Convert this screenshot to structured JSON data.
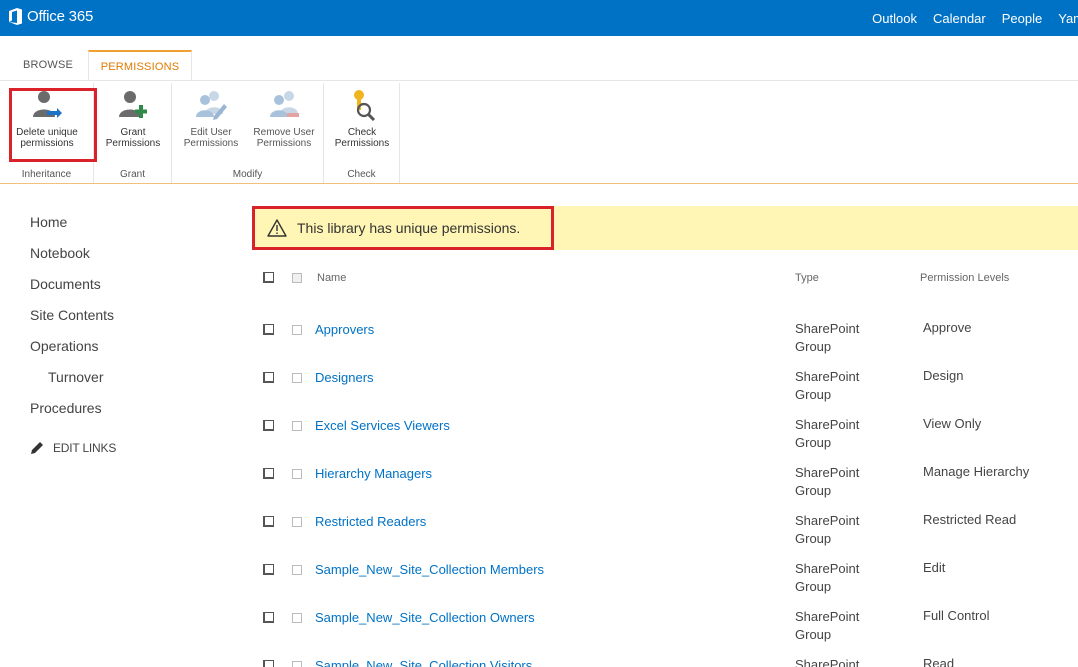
{
  "suite_bar": {
    "brand": "Office 365",
    "links": [
      "Outlook",
      "Calendar",
      "People",
      "Yam"
    ],
    "color": "#0072c6"
  },
  "ribbon": {
    "tabs": [
      "BROWSE",
      "PERMISSIONS"
    ],
    "active_tab": "PERMISSIONS",
    "groups": [
      {
        "label": "Inheritance",
        "buttons": [
          {
            "label": "Delete unique\npermissions",
            "icon": "delete-inheritance-icon"
          }
        ]
      },
      {
        "label": "Grant",
        "buttons": [
          {
            "label": "Grant\nPermissions",
            "icon": "grant-permissions-icon"
          }
        ]
      },
      {
        "label": "Modify",
        "buttons": [
          {
            "label": "Edit User\nPermissions",
            "icon": "edit-user-permissions-icon"
          },
          {
            "label": "Remove User\nPermissions",
            "icon": "remove-user-permissions-icon"
          }
        ]
      },
      {
        "label": "Check",
        "buttons": [
          {
            "label": "Check\nPermissions",
            "icon": "check-permissions-icon"
          }
        ]
      }
    ]
  },
  "left_nav": {
    "items": [
      "Home",
      "Notebook",
      "Documents",
      "Site Contents",
      "Operations",
      "Turnover",
      "Procedures"
    ],
    "edit_links": "EDIT LINKS"
  },
  "notice": {
    "text": "This library has unique permissions.",
    "icon": "warning-icon"
  },
  "table": {
    "columns": [
      "Name",
      "Type",
      "Permission Levels"
    ],
    "rows": [
      {
        "name": "Approvers",
        "type": "SharePoint Group",
        "level": "Approve"
      },
      {
        "name": "Designers",
        "type": "SharePoint Group",
        "level": "Design"
      },
      {
        "name": "Excel Services Viewers",
        "type": "SharePoint Group",
        "level": "View Only"
      },
      {
        "name": "Hierarchy Managers",
        "type": "SharePoint Group",
        "level": "Manage Hierarchy"
      },
      {
        "name": "Restricted Readers",
        "type": "SharePoint Group",
        "level": "Restricted Read"
      },
      {
        "name": "Sample_New_Site_Collection Members",
        "type": "SharePoint Group",
        "level": "Edit"
      },
      {
        "name": "Sample_New_Site_Collection Owners",
        "type": "SharePoint Group",
        "level": "Full Control"
      },
      {
        "name": "Sample_New_Site_Collection Visitors",
        "type": "SharePoint Group",
        "level": "Read"
      }
    ]
  }
}
